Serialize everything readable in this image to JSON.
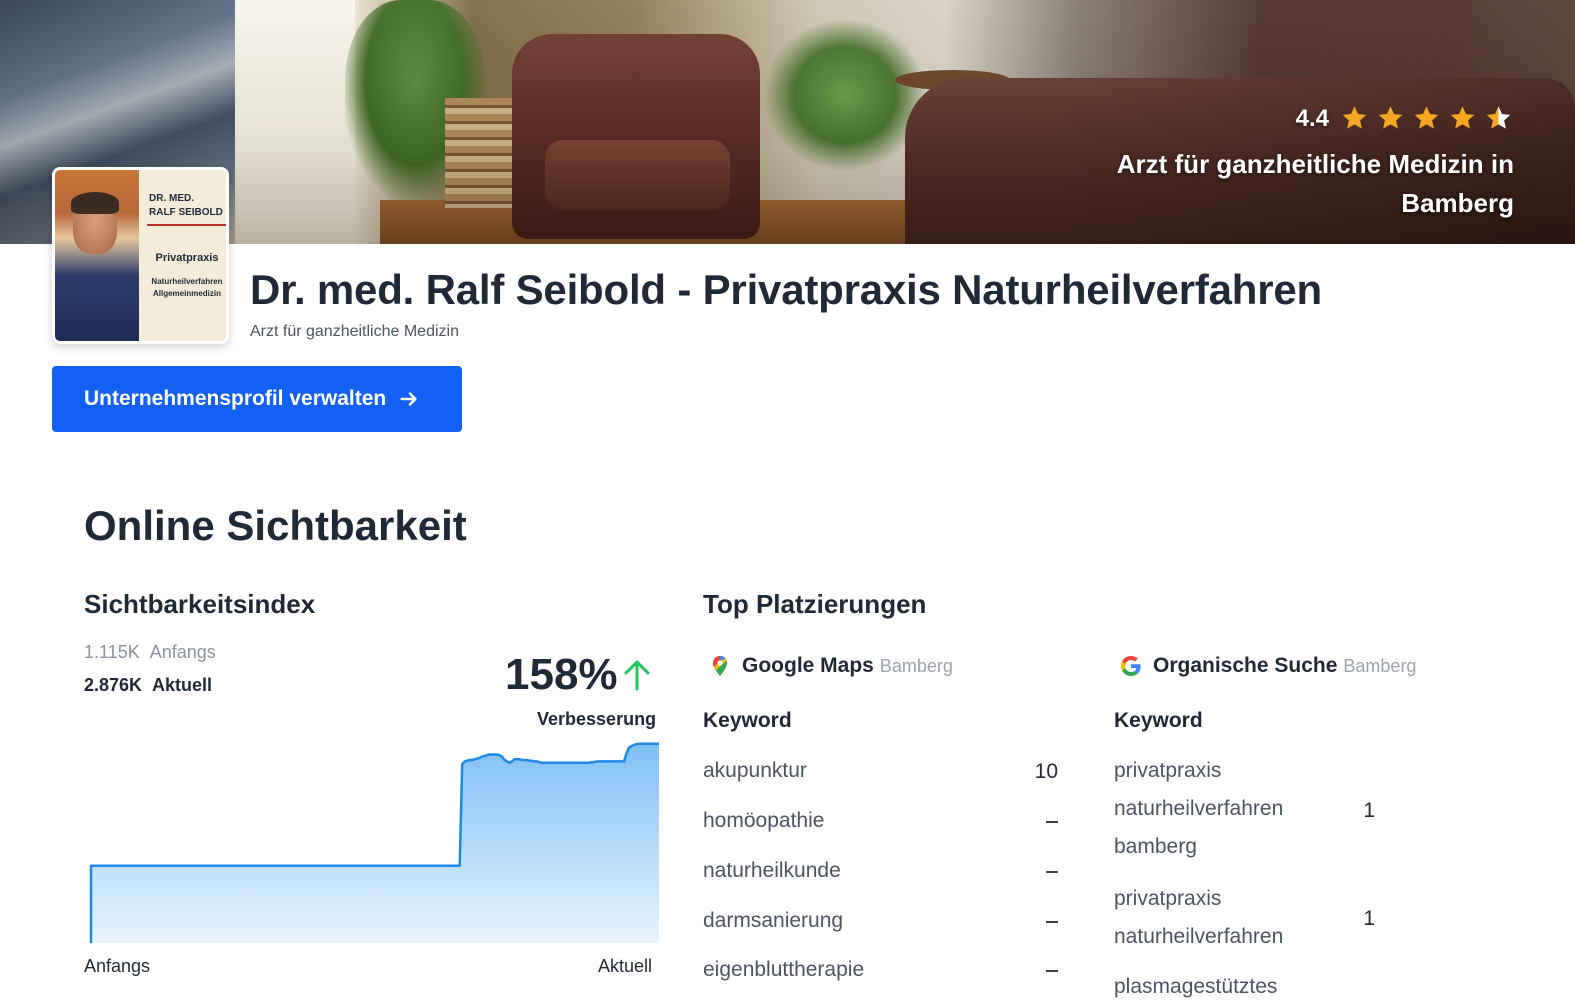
{
  "hero": {
    "rating": "4.4",
    "stars": 4.5,
    "caption": "Arzt für ganzheitliche Medizin in Bamberg"
  },
  "logo": {
    "name_line1": "DR. MED.",
    "name_line2": "RALF SEIBOLD",
    "line1": "Privatpraxis",
    "line2": "Naturheilverfahren",
    "line3": "Allgemeinmedizin"
  },
  "business": {
    "title": "Dr. med. Ralf Seibold - Privatpraxis Naturheilverfahren",
    "subtitle": "Arzt für ganzheitliche Medizin"
  },
  "cta": {
    "label": "Unternehmensprofil verwalten"
  },
  "visibility": {
    "section_title": "Online Sichtbarkeit",
    "heading": "Sichtbarkeitsindex",
    "start_value": "1.115K",
    "start_label": "Anfangs",
    "current_value": "2.876K",
    "current_label": "Aktuell",
    "improvement": "158%",
    "improvement_label": "Verbesserung",
    "axis_start": "Anfangs",
    "axis_end": "Aktuell"
  },
  "chart_data": {
    "type": "area",
    "title": "",
    "xlabel": "",
    "ylabel": "",
    "x_labels": [
      "Anfangs",
      "Aktuell"
    ],
    "values": [
      1.115,
      1.115,
      1.115,
      1.115,
      1.115,
      1.115,
      1.115,
      1.115,
      1.115,
      1.115,
      1.115,
      1.115,
      1.115,
      1.115,
      1.115,
      1.115,
      1.115,
      1.115,
      1.115,
      1.115,
      1.115,
      1.115,
      1.115,
      1.115,
      1.115,
      1.115,
      1.115,
      1.115,
      1.115,
      1.115,
      1.115,
      1.115,
      1.115,
      1.115,
      1.115,
      1.115,
      1.115,
      1.115,
      1.115,
      1.115,
      1.115,
      1.115,
      1.115,
      1.115,
      1.115,
      1.115,
      1.115,
      1.115,
      1.115,
      1.115,
      1.115,
      1.115,
      1.115,
      1.115,
      1.115,
      1.115,
      1.115,
      1.115,
      1.115,
      1.115,
      1.115,
      1.115,
      1.115,
      1.115,
      1.115,
      1.115,
      1.115,
      1.115,
      1.115,
      1.115,
      1.115,
      1.115,
      1.115,
      1.115,
      1.115,
      1.115,
      1.115,
      1.115,
      1.115,
      1.115,
      1.115,
      1.115,
      1.115,
      1.115,
      1.115,
      1.115,
      1.115,
      1.115,
      1.115,
      1.115,
      1.115,
      1.115,
      1.115,
      1.115,
      1.115,
      1.115,
      1.115,
      1.115,
      1.115,
      1.115,
      1.115,
      1.115,
      1.115,
      1.115,
      1.115,
      1.115,
      1.115,
      1.115,
      1.115,
      1.115,
      1.115,
      1.115,
      1.115,
      1.115,
      1.115,
      1.115,
      1.115,
      1.115,
      1.115,
      1.115,
      1.115,
      1.115,
      1.115,
      1.115,
      1.115,
      1.115,
      1.115,
      1.115,
      1.115,
      1.115,
      1.115,
      1.115,
      1.115,
      1.115,
      1.115,
      1.115,
      1.115,
      1.115,
      1.115,
      1.115,
      1.115,
      1.115,
      1.115,
      1.115,
      1.115,
      1.115,
      1.115,
      1.115,
      1.115,
      2.58,
      2.62,
      2.63,
      2.64,
      2.64,
      2.65,
      2.66,
      2.67,
      2.69,
      2.7,
      2.71,
      2.72,
      2.72,
      2.72,
      2.72,
      2.71,
      2.69,
      2.64,
      2.62,
      2.6,
      2.62,
      2.65,
      2.65,
      2.65,
      2.64,
      2.64,
      2.64,
      2.63,
      2.63,
      2.62,
      2.62,
      2.61,
      2.6,
      2.6,
      2.6,
      2.6,
      2.6,
      2.6,
      2.6,
      2.6,
      2.6,
      2.6,
      2.6,
      2.6,
      2.6,
      2.6,
      2.6,
      2.6,
      2.6,
      2.6,
      2.6,
      2.6,
      2.61,
      2.61,
      2.62,
      2.62,
      2.62,
      2.62,
      2.62,
      2.62,
      2.62,
      2.62,
      2.62,
      2.62,
      2.62,
      2.62,
      2.74,
      2.82,
      2.84,
      2.86,
      2.87,
      2.876,
      2.876,
      2.876,
      2.876,
      2.876,
      2.876,
      2.876,
      2.876,
      2.876
    ],
    "ylim": [
      0,
      2.9
    ],
    "grid": false,
    "legend": "none"
  },
  "rankings": {
    "heading": "Top Platzierungen",
    "maps": {
      "label": "Google Maps",
      "location": "Bamberg",
      "keyword_header": "Keyword",
      "rows": [
        {
          "keyword": "akupunktur",
          "rank": "10"
        },
        {
          "keyword": "homöopathie",
          "rank": "–"
        },
        {
          "keyword": "naturheilkunde",
          "rank": "–"
        },
        {
          "keyword": "darmsanierung",
          "rank": "–"
        },
        {
          "keyword": "eigenbluttherapie",
          "rank": "–"
        }
      ]
    },
    "organic": {
      "label": "Organische Suche",
      "location": "Bamberg",
      "keyword_header": "Keyword",
      "rows": [
        {
          "keyword_lines": [
            "privatpraxis",
            "naturheilverfahren",
            "bamberg"
          ],
          "rank": "1"
        },
        {
          "keyword_lines": [
            "privatpraxis",
            "naturheilverfahren"
          ],
          "rank": "1"
        },
        {
          "keyword_lines": [
            "plasmagestütztes"
          ],
          "rank": ""
        }
      ]
    }
  },
  "colors": {
    "primary": "#1460f2",
    "star": "#f5a623",
    "up_arrow": "#22c55e",
    "chart_line": "#1e88e5"
  },
  "icons": [
    "star-icon",
    "arrow-right-icon",
    "arrow-up-icon",
    "map-pin-icon",
    "google-g-icon"
  ]
}
